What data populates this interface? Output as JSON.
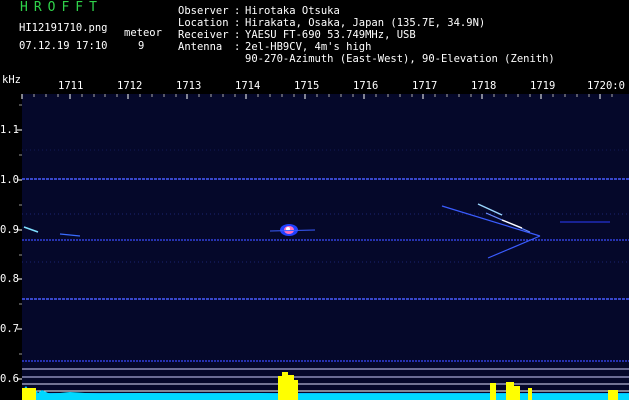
{
  "header": {
    "app_title": "HROFFT",
    "file_name": "HI12191710.png",
    "timestamp": "07.12.19 17:10",
    "meteor_label": "meteor",
    "meteor_count": "9"
  },
  "station": {
    "observer_label": "Observer",
    "observer_value": "Hirotaka Otsuka",
    "location_label": "Location",
    "location_value": "Hirakata, Osaka, Japan (135.7E, 34.9N)",
    "receiver_label": "Receiver",
    "receiver_value": "YAESU FT-690 53.749MHz, USB",
    "antenna_label": "Antenna",
    "antenna_value": "2el-HB9CV, 4m's high",
    "antenna_value2": "90-270-Azimuth (East-West), 90-Elevation (Zenith)"
  },
  "axes": {
    "y_unit": "kHz",
    "time_labels": [
      "1711",
      "1712",
      "1713",
      "1714",
      "1715",
      "1716",
      "1717",
      "1718",
      "1719",
      "1720:0"
    ],
    "freq_labels": [
      "1.1",
      "1.0",
      "0.9",
      "0.8",
      "0.7",
      "0.6"
    ]
  },
  "colors": {
    "title": "#2fd24a",
    "text": "#ffffff",
    "background": "#000000",
    "plot_bg": "#05082a",
    "carrier": "#3a4cff",
    "meteor": "#ffffff",
    "spectrum_yellow": "#ffff00",
    "spectrum_cyan": "#00ffff"
  }
}
